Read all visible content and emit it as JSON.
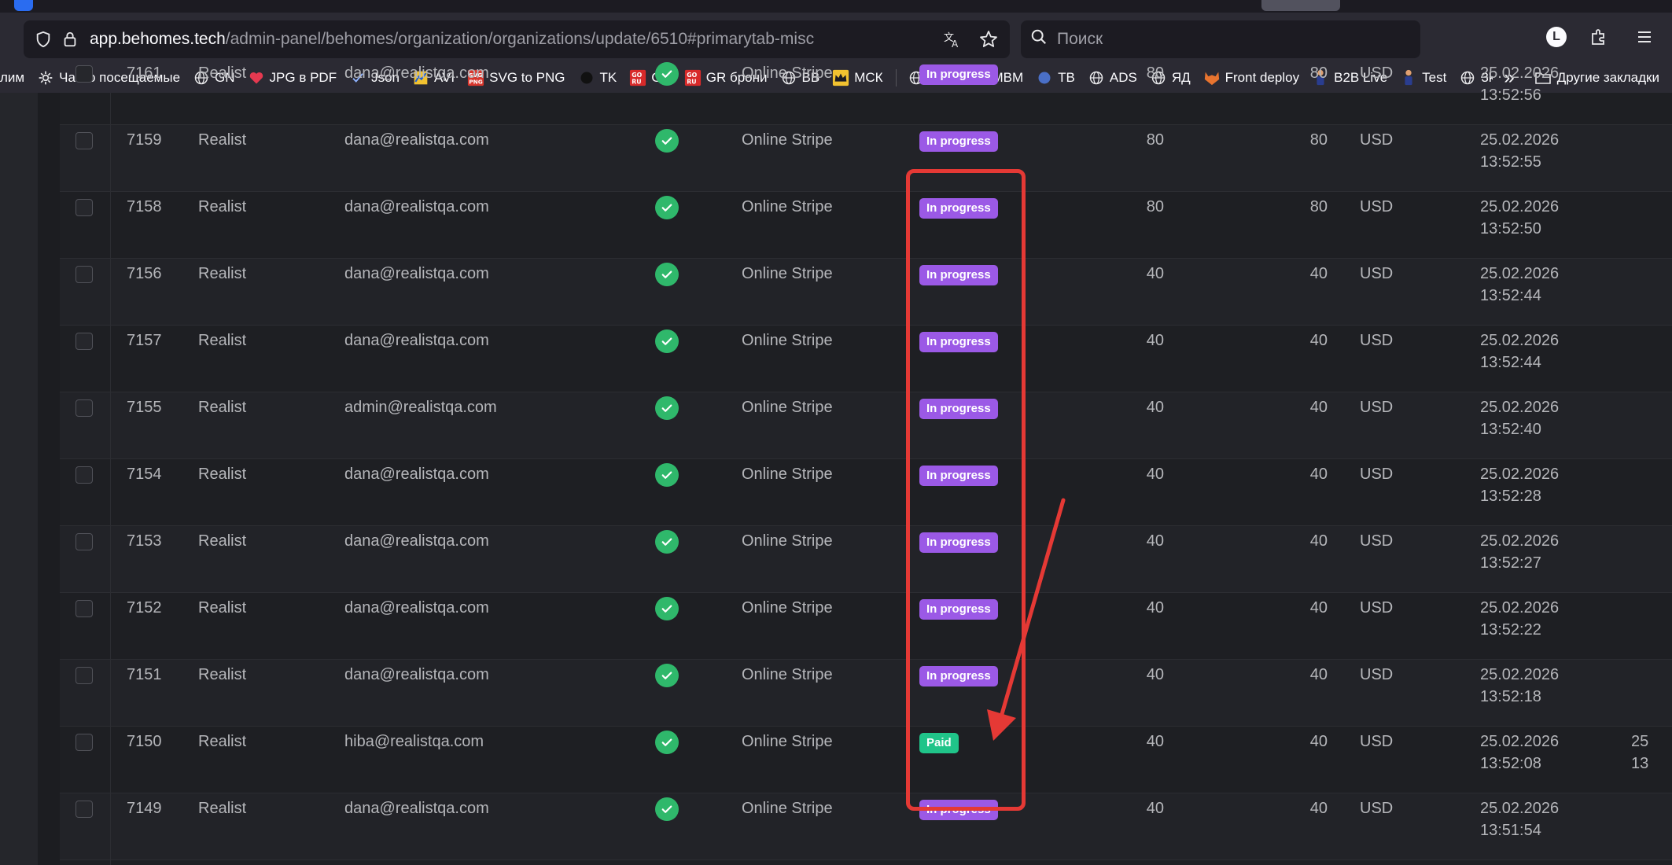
{
  "browser": {
    "url_host": "app.behomes.tech",
    "url_path": "/admin-panel/behomes/organization/organizations/update/6510#primarytab-misc",
    "search_placeholder": "Поиск",
    "avatar_letter": "L",
    "bookmarks": [
      {
        "label": "лим",
        "icon": "none"
      },
      {
        "label": "Часто посещаемые",
        "icon": "gear-icon"
      },
      {
        "label": "GN",
        "icon": "globe-icon"
      },
      {
        "label": "JPG в PDF",
        "icon": "heart-icon"
      },
      {
        "label": "Json",
        "icon": "check-icon"
      },
      {
        "label": "AVI",
        "icon": "chart-icon"
      },
      {
        "label": "SVG to PNG",
        "icon": "svg-icon"
      },
      {
        "label": "TK",
        "icon": "circle-icon"
      },
      {
        "label": "GR",
        "icon": "goru-icon"
      },
      {
        "label": "GR брони",
        "icon": "goru-icon"
      },
      {
        "label": "BB",
        "icon": "globe-icon"
      },
      {
        "label": "МСК",
        "icon": "crown-icon"
      },
      {
        "label": "OTC",
        "icon": "globe-icon"
      },
      {
        "label": "MBM",
        "icon": "globe-icon"
      },
      {
        "label": "TB",
        "icon": "dot-icon"
      },
      {
        "label": "ADS",
        "icon": "globe-icon"
      },
      {
        "label": "ЯД",
        "icon": "globe-icon"
      },
      {
        "label": "Front deploy",
        "icon": "fox-icon"
      },
      {
        "label": "B2B Live",
        "icon": "figure-icon"
      },
      {
        "label": "Test",
        "icon": "figure-icon"
      },
      {
        "label": "3k6w",
        "icon": "globe-icon"
      }
    ],
    "other_bookmarks": "Другие закладки",
    "overflow": "»"
  },
  "colors": {
    "in_progress": "#9b59e6",
    "paid": "#20c489",
    "check": "#2fb86b",
    "annotation": "#e53935"
  },
  "table": {
    "rows": [
      {
        "id": "7161",
        "org": "Realist",
        "email": "dana@realistqa.com",
        "method": "Online Stripe",
        "status": "In progress",
        "status_type": "progress",
        "amount": "80",
        "amount2": "80",
        "currency": "USD",
        "date": "25.02.2026",
        "time": "13:52:56",
        "partial": true
      },
      {
        "id": "7159",
        "org": "Realist",
        "email": "dana@realistqa.com",
        "method": "Online Stripe",
        "status": "In progress",
        "status_type": "progress",
        "amount": "80",
        "amount2": "80",
        "currency": "USD",
        "date": "25.02.2026",
        "time": "13:52:55"
      },
      {
        "id": "7158",
        "org": "Realist",
        "email": "dana@realistqa.com",
        "method": "Online Stripe",
        "status": "In progress",
        "status_type": "progress",
        "amount": "80",
        "amount2": "80",
        "currency": "USD",
        "date": "25.02.2026",
        "time": "13:52:50"
      },
      {
        "id": "7156",
        "org": "Realist",
        "email": "dana@realistqa.com",
        "method": "Online Stripe",
        "status": "In progress",
        "status_type": "progress",
        "amount": "40",
        "amount2": "40",
        "currency": "USD",
        "date": "25.02.2026",
        "time": "13:52:44"
      },
      {
        "id": "7157",
        "org": "Realist",
        "email": "dana@realistqa.com",
        "method": "Online Stripe",
        "status": "In progress",
        "status_type": "progress",
        "amount": "40",
        "amount2": "40",
        "currency": "USD",
        "date": "25.02.2026",
        "time": "13:52:44"
      },
      {
        "id": "7155",
        "org": "Realist",
        "email": "admin@realistqa.com",
        "method": "Online Stripe",
        "status": "In progress",
        "status_type": "progress",
        "amount": "40",
        "amount2": "40",
        "currency": "USD",
        "date": "25.02.2026",
        "time": "13:52:40"
      },
      {
        "id": "7154",
        "org": "Realist",
        "email": "dana@realistqa.com",
        "method": "Online Stripe",
        "status": "In progress",
        "status_type": "progress",
        "amount": "40",
        "amount2": "40",
        "currency": "USD",
        "date": "25.02.2026",
        "time": "13:52:28"
      },
      {
        "id": "7153",
        "org": "Realist",
        "email": "dana@realistqa.com",
        "method": "Online Stripe",
        "status": "In progress",
        "status_type": "progress",
        "amount": "40",
        "amount2": "40",
        "currency": "USD",
        "date": "25.02.2026",
        "time": "13:52:27"
      },
      {
        "id": "7152",
        "org": "Realist",
        "email": "dana@realistqa.com",
        "method": "Online Stripe",
        "status": "In progress",
        "status_type": "progress",
        "amount": "40",
        "amount2": "40",
        "currency": "USD",
        "date": "25.02.2026",
        "time": "13:52:22"
      },
      {
        "id": "7151",
        "org": "Realist",
        "email": "dana@realistqa.com",
        "method": "Online Stripe",
        "status": "In progress",
        "status_type": "progress",
        "amount": "40",
        "amount2": "40",
        "currency": "USD",
        "date": "25.02.2026",
        "time": "13:52:18"
      },
      {
        "id": "7150",
        "org": "Realist",
        "email": "hiba@realistqa.com",
        "method": "Online Stripe",
        "status": "Paid",
        "status_type": "paid",
        "amount": "40",
        "amount2": "40",
        "currency": "USD",
        "date": "25.02.2026",
        "time": "13:52:08",
        "extra_date": "25",
        "extra_time": "13"
      },
      {
        "id": "7149",
        "org": "Realist",
        "email": "dana@realistqa.com",
        "method": "Online Stripe",
        "status": "In progress",
        "status_type": "progress",
        "amount": "40",
        "amount2": "40",
        "currency": "USD",
        "date": "25.02.2026",
        "time": "13:51:54"
      }
    ]
  }
}
